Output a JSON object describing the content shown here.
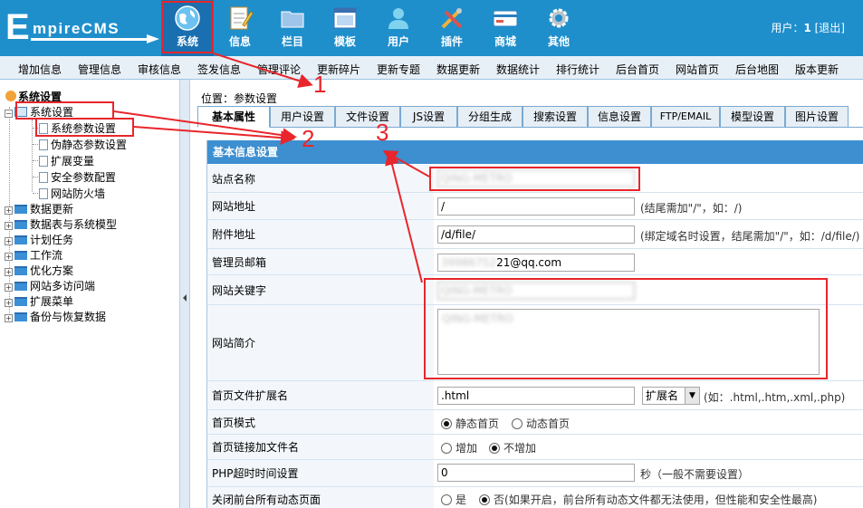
{
  "header": {
    "logo_initial": "E",
    "logo_rest": "mpireCMS",
    "nav": [
      {
        "label": "系统",
        "icon": "globe-icon"
      },
      {
        "label": "信息",
        "icon": "notepad-icon"
      },
      {
        "label": "栏目",
        "icon": "folder-icon"
      },
      {
        "label": "模板",
        "icon": "window-icon"
      },
      {
        "label": "用户",
        "icon": "user-icon"
      },
      {
        "label": "插件",
        "icon": "tools-icon"
      },
      {
        "label": "商城",
        "icon": "card-icon"
      },
      {
        "label": "其他",
        "icon": "gear-icon"
      }
    ],
    "user_label": "用户：",
    "user_name": "1",
    "logout": "[退出]"
  },
  "submenu": [
    "增加信息",
    "管理信息",
    "审核信息",
    "签发信息",
    "管理评论",
    "更新碎片",
    "更新专题",
    "数据更新",
    "数据统计",
    "排行统计",
    "后台首页",
    "网站首页",
    "后台地图",
    "版本更新"
  ],
  "sidebar": {
    "root": "系统设置",
    "open_folder": "系统设置",
    "children": [
      "系统参数设置",
      "伪静态参数设置",
      "扩展变量",
      "安全参数配置",
      "网站防火墙"
    ],
    "folders": [
      "数据更新",
      "数据表与系统模型",
      "计划任务",
      "工作流",
      "优化方案",
      "网站多访问端",
      "扩展菜单",
      "备份与恢复数据"
    ]
  },
  "breadcrumb": "位置：参数设置",
  "tabs": [
    "基本属性",
    "用户设置",
    "文件设置",
    "JS设置",
    "分组生成",
    "搜索设置",
    "信息设置",
    "FTP/EMAIL",
    "模型设置",
    "图片设置"
  ],
  "form": {
    "section_title": "基本信息设置",
    "site_name": {
      "label": "站点名称",
      "value": "QING-METRO"
    },
    "site_url": {
      "label": "网站地址",
      "value": "/",
      "hint": "(结尾需加\"/\"，如：/)"
    },
    "attach_url": {
      "label": "附件地址",
      "value": "/d/file/",
      "hint": "(绑定域名时设置，结尾需加\"/\"，如：/d/file/)"
    },
    "admin_email": {
      "label": "管理员邮箱",
      "value_hidden": "39986752",
      "value_visible": "21@qq.com"
    },
    "keywords": {
      "label": "网站关键字",
      "value": "QING-METRO"
    },
    "intro": {
      "label": "网站简介",
      "value": "QING-METRO"
    },
    "index_ext": {
      "label": "首页文件扩展名",
      "value": ".html",
      "select": "扩展名",
      "hint": "(如：.html,.htm,.xml,.php)"
    },
    "index_mode": {
      "label": "首页模式",
      "opt1": "静态首页",
      "opt2": "动态首页"
    },
    "index_link": {
      "label": "首页链接加文件名",
      "opt1": "增加",
      "opt2": "不增加"
    },
    "php_timeout": {
      "label": "PHP超时时间设置",
      "value": "0",
      "hint": "秒（一般不需要设置）"
    },
    "close_dynamic": {
      "label": "关闭前台所有动态页面",
      "opt1": "是",
      "opt2": "否",
      "hint": "(如果开启，前台所有动态文件都无法使用，但性能和安全性最高)"
    }
  },
  "annotations": [
    "1",
    "2",
    "3"
  ],
  "colors": {
    "header": "#1f8fcc",
    "annotation": "#e8262b",
    "form_header": "#3d8fd0"
  }
}
